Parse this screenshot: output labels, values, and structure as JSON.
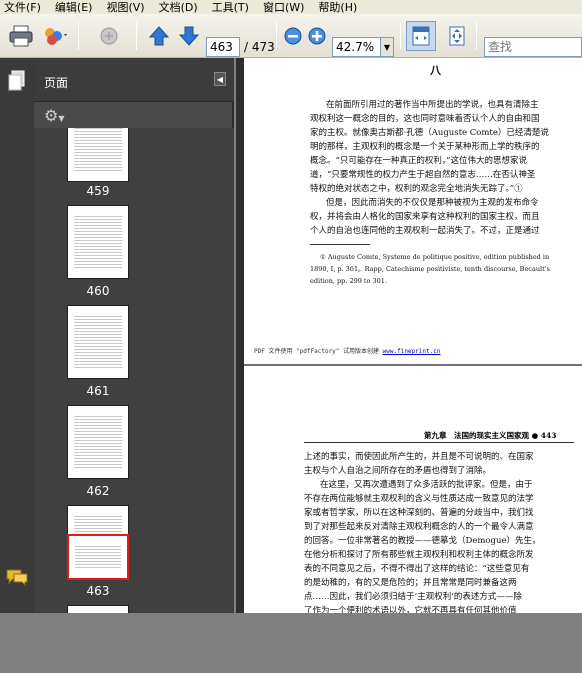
{
  "menu": [
    "文件(F)",
    "编辑(E)",
    "视图(V)",
    "文档(D)",
    "工具(T)",
    "窗口(W)",
    "帮助(H)"
  ],
  "toolbar": {
    "current_page": "463",
    "total_pages": "/ 473",
    "zoom": "42.7%",
    "search_placeholder": "查找"
  },
  "panel": {
    "title": "页面",
    "thumbnails": [
      {
        "label": "459"
      },
      {
        "label": "460"
      },
      {
        "label": "461"
      },
      {
        "label": "462"
      },
      {
        "label": "463"
      }
    ]
  },
  "page1": {
    "heading": "八",
    "paragraphs": [
      "在前面所引用过的著作当中所提出的学说，也具有清除主",
      "观权利这一概念的目的，这也同时意味着否认个人的自由和国",
      "家的主权。就像奥古斯都·孔德（Auguste Comte）已经清楚说",
      "明的那样，主观权利的概念是一个关于某种形而上学的秩序的",
      "概念。“只可能存在一种真正的权利，”这位伟大的思想家说",
      "道，“只要常规性的权力产生于超自然的意志……在否认神圣",
      "特权的绝对状态之中，权利的观念完全地消失无踪了。”①",
      "但是，因此而消失的不仅仅是那种被视为主观的发布命令",
      "权，并将会由人格化的国家来享有这种权利的国家主权，而且",
      "个人的自治也连同他的主观权利一起消失了。不过，正是通过"
    ],
    "footnote": [
      "① Auguste Comte, Systeme de politique positive, edition published in",
      "1890, I, p. 361。Rapp, Catechisme positiviste, tenth discourse, Becault's",
      "edition, pp. 299 to 301."
    ],
    "footer_text": "PDF 文件使用 \"pdfFactory\" 试用版本创建 ",
    "footer_link": "www.fineprint.cn"
  },
  "page2": {
    "header": "第九章　法国的现实主义国家观 ● 443",
    "paragraphs": [
      "上述的事实，而使因此所产生的，并且是不可说明的、在国家",
      "主权与个人自治之间所存在的矛盾也得到了消除。",
      "在这里，又再次遭遇到了众多活跃的批评家。但是，由于",
      "不存在两位能够就主观权利的含义与性质达成一致意见的法学",
      "家或者哲学家，所以在这种深刻的、普遍的分歧当中，我们找",
      "到了对那些起来反对清除主观权利概念的人的一个最令人满意",
      "的回答。一位非常著名的教授——德摹戈（Demogue）先生，",
      "在他分析和探讨了所有那些就主观权利和权利主体的概念所发",
      "表的不同意见之后，不得不得出了这样的结论：“这些意见有",
      "的是幼稚的，有的又是危险的；并且常常是同时兼备这两",
      "点……因此，我们必须归结于‘主观权利’的表述方式——除",
      "了作为一个便利的术语以外，它就不再具有任何其他价值"
    ]
  }
}
